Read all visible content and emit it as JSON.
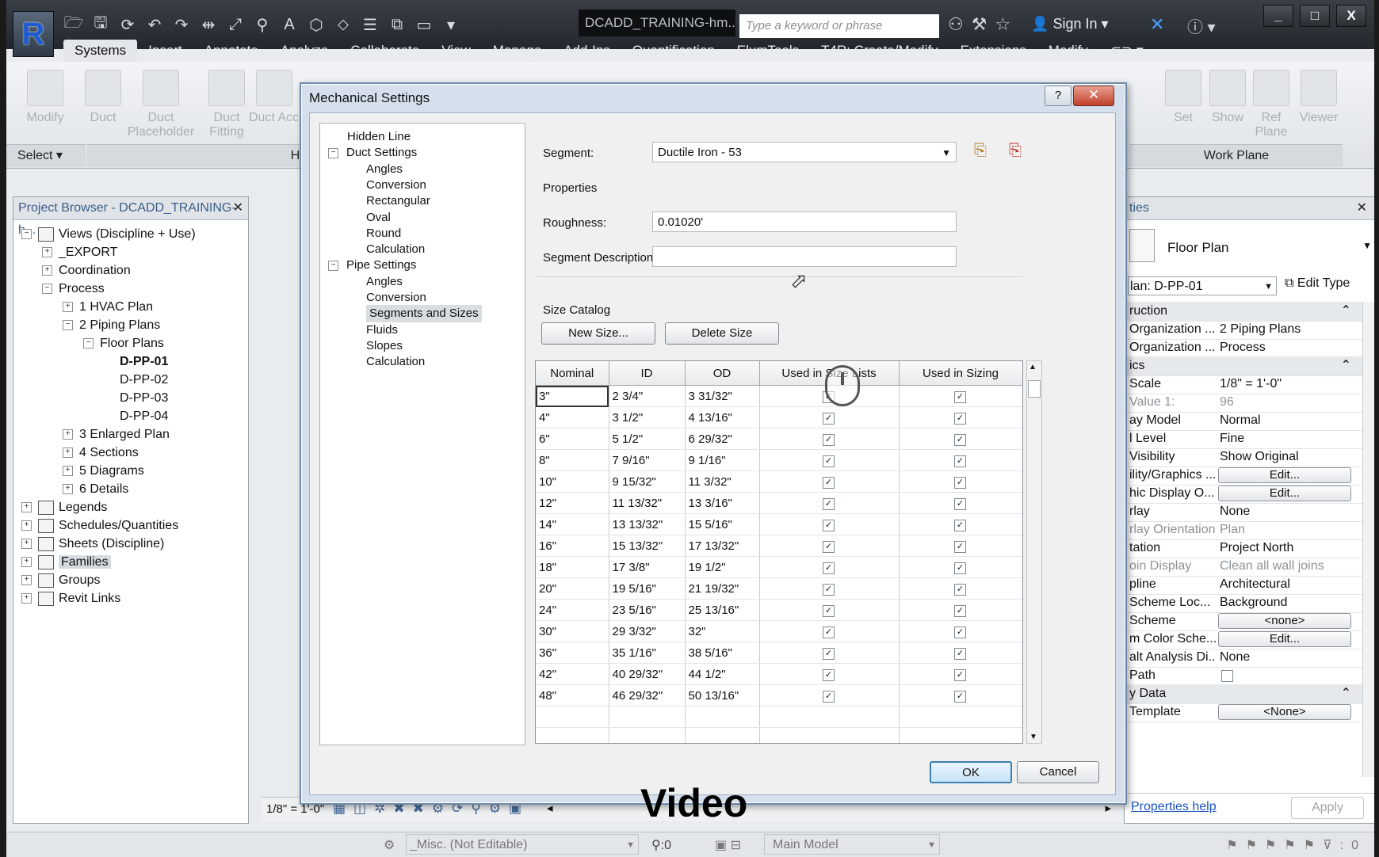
{
  "app": {
    "logo_letter": "R",
    "doc_title": "DCADD_TRAINING-hm...",
    "search_placeholder": "Type a keyword or phrase",
    "sign_in": "Sign In",
    "window_controls": [
      "_",
      "□",
      "X"
    ]
  },
  "ribbon": {
    "tabs": [
      "Systems",
      "Insert",
      "Annotate",
      "Analyze",
      "Collaborate",
      "View",
      "Manage",
      "Add-Ins",
      "Quantification",
      "ElumTools",
      "T4R: Create/Modify",
      "Extensions",
      "Modify"
    ],
    "active_tab": "Systems",
    "tools": [
      "Modify",
      "Duct",
      "Duct Placeholder",
      "Duct Fitting",
      "Duct Access",
      "Set",
      "Show",
      "Ref Plane",
      "Viewer"
    ],
    "panels": {
      "select": "Select ▾",
      "hvac": "HVAC",
      "work_plane": "Work Plane"
    }
  },
  "project_browser": {
    "title": "Project Browser - DCADD_TRAINING-h...",
    "close": "✕",
    "tree": [
      {
        "label": "Views (Discipline + Use)",
        "level": 0,
        "toggle": "−",
        "icon": true
      },
      {
        "label": "_EXPORT",
        "level": 1,
        "toggle": "+"
      },
      {
        "label": "Coordination",
        "level": 1,
        "toggle": "+"
      },
      {
        "label": "Process",
        "level": 1,
        "toggle": "−"
      },
      {
        "label": "1 HVAC Plan",
        "level": 2,
        "toggle": "+"
      },
      {
        "label": "2 Piping Plans",
        "level": 2,
        "toggle": "−"
      },
      {
        "label": "Floor Plans",
        "level": 3,
        "toggle": "−"
      },
      {
        "label": "D-PP-01",
        "level": 4,
        "bold": true
      },
      {
        "label": "D-PP-02",
        "level": 4
      },
      {
        "label": "D-PP-03",
        "level": 4
      },
      {
        "label": "D-PP-04",
        "level": 4
      },
      {
        "label": "3 Enlarged Plan",
        "level": 2,
        "toggle": "+"
      },
      {
        "label": "4 Sections",
        "level": 2,
        "toggle": "+"
      },
      {
        "label": "5 Diagrams",
        "level": 2,
        "toggle": "+"
      },
      {
        "label": "6 Details",
        "level": 2,
        "toggle": "+"
      },
      {
        "label": "Legends",
        "level": 0,
        "toggle": "+",
        "icon": true
      },
      {
        "label": "Schedules/Quantities",
        "level": 0,
        "toggle": "+",
        "icon": true
      },
      {
        "label": "Sheets (Discipline)",
        "level": 0,
        "toggle": "+",
        "icon": true
      },
      {
        "label": "Families",
        "level": 0,
        "toggle": "+",
        "icon": true,
        "highlight": true
      },
      {
        "label": "Groups",
        "level": 0,
        "toggle": "+",
        "icon": true
      },
      {
        "label": "Revit Links",
        "level": 0,
        "toggle": "+",
        "icon": true
      }
    ]
  },
  "properties": {
    "title": "ties",
    "type_name": "Floor Plan",
    "instance_selector": "lan: D-PP-01",
    "edit_type": "Edit Type",
    "rows": [
      {
        "k": "ruction",
        "v": "",
        "section": true,
        "toggle": "⌃"
      },
      {
        "k": "Organization ...",
        "v": "2 Piping Plans"
      },
      {
        "k": "Organization ...",
        "v": "Process"
      },
      {
        "k": "ics",
        "v": "",
        "section": true,
        "toggle": "⌃"
      },
      {
        "k": "Scale",
        "v": "1/8\" = 1'-0\""
      },
      {
        "k": "Value  1:",
        "v": "96",
        "grey": true
      },
      {
        "k": "ay Model",
        "v": "Normal"
      },
      {
        "k": "l Level",
        "v": "Fine"
      },
      {
        "k": "Visibility",
        "v": "Show Original"
      },
      {
        "k": "ility/Graphics ...",
        "v": "Edit...",
        "button": true
      },
      {
        "k": "hic Display O...",
        "v": "Edit...",
        "button": true
      },
      {
        "k": "rlay",
        "v": "None"
      },
      {
        "k": "rlay Orientation",
        "v": "Plan",
        "grey": true
      },
      {
        "k": "tation",
        "v": "Project North"
      },
      {
        "k": "oin Display",
        "v": "Clean all wall joins",
        "grey": true
      },
      {
        "k": "pline",
        "v": "Architectural"
      },
      {
        "k": "Scheme Loc...",
        "v": "Background"
      },
      {
        "k": "Scheme",
        "v": "<none>",
        "button": true
      },
      {
        "k": "m Color Sche...",
        "v": "Edit...",
        "button": true
      },
      {
        "k": "alt Analysis Di...",
        "v": "None"
      },
      {
        "k": "Path",
        "v": "",
        "checkbox": true
      },
      {
        "k": "y Data",
        "v": "",
        "section": true,
        "toggle": "⌃"
      },
      {
        "k": "Template",
        "v": "<None>",
        "button": true
      }
    ],
    "help_link": "Properties help",
    "apply": "Apply"
  },
  "dialog": {
    "title": "Mechanical Settings",
    "help": "?",
    "close": "✕",
    "nav": [
      {
        "label": "Hidden Line",
        "level": 0
      },
      {
        "label": "Duct Settings",
        "level": 0,
        "toggle": "−"
      },
      {
        "label": "Angles",
        "level": 1
      },
      {
        "label": "Conversion",
        "level": 1
      },
      {
        "label": "Rectangular",
        "level": 1
      },
      {
        "label": "Oval",
        "level": 1
      },
      {
        "label": "Round",
        "level": 1
      },
      {
        "label": "Calculation",
        "level": 1
      },
      {
        "label": "Pipe Settings",
        "level": 0,
        "toggle": "−"
      },
      {
        "label": "Angles",
        "level": 1
      },
      {
        "label": "Conversion",
        "level": 1
      },
      {
        "label": "Segments and Sizes",
        "level": 1,
        "selected": true
      },
      {
        "label": "Fluids",
        "level": 1
      },
      {
        "label": "Slopes",
        "level": 1
      },
      {
        "label": "Calculation",
        "level": 1
      }
    ],
    "segment_label": "Segment:",
    "segment_value": "Ductile Iron - 53",
    "properties_label": "Properties",
    "roughness_label": "Roughness:",
    "roughness_value": "0.01020'",
    "segment_description_label": "Segment Description:",
    "segment_description_value": "",
    "size_catalog_label": "Size Catalog",
    "new_size": "New Size...",
    "delete_size": "Delete Size",
    "columns": [
      "Nominal",
      "ID",
      "OD",
      "Used in Size Lists",
      "Used in Sizing"
    ],
    "rows": [
      {
        "nominal": "3\"",
        "id": "2 3/4\"",
        "od": "3 31/32\""
      },
      {
        "nominal": "4\"",
        "id": "3 1/2\"",
        "od": "4 13/16\""
      },
      {
        "nominal": "6\"",
        "id": "5 1/2\"",
        "od": "6 29/32\""
      },
      {
        "nominal": "8\"",
        "id": "7 9/16\"",
        "od": "9 1/16\""
      },
      {
        "nominal": "10\"",
        "id": "9 15/32\"",
        "od": "11 3/32\""
      },
      {
        "nominal": "12\"",
        "id": "11 13/32\"",
        "od": "13 3/16\""
      },
      {
        "nominal": "14\"",
        "id": "13 13/32\"",
        "od": "15 5/16\""
      },
      {
        "nominal": "16\"",
        "id": "15 13/32\"",
        "od": "17 13/32\""
      },
      {
        "nominal": "18\"",
        "id": "17 3/8\"",
        "od": "19 1/2\""
      },
      {
        "nominal": "20\"",
        "id": "19 5/16\"",
        "od": "21 19/32\""
      },
      {
        "nominal": "24\"",
        "id": "23 5/16\"",
        "od": "25 13/16\""
      },
      {
        "nominal": "30\"",
        "id": "29 3/32\"",
        "od": "32\""
      },
      {
        "nominal": "36\"",
        "id": "35 1/16\"",
        "od": "38 5/16\""
      },
      {
        "nominal": "42\"",
        "id": "40 29/32\"",
        "od": "44 1/2\""
      },
      {
        "nominal": "48\"",
        "id": "46 29/32\"",
        "od": "50 13/16\""
      }
    ],
    "ok": "OK",
    "cancel": "Cancel"
  },
  "view_bar": {
    "scale": "1/8\" = 1'-0\""
  },
  "status_bar": {
    "workset": "_Misc. (Not Editable)",
    "count": ":0",
    "model": "Main Model",
    "filter_count": ":0"
  },
  "caption": "Video"
}
